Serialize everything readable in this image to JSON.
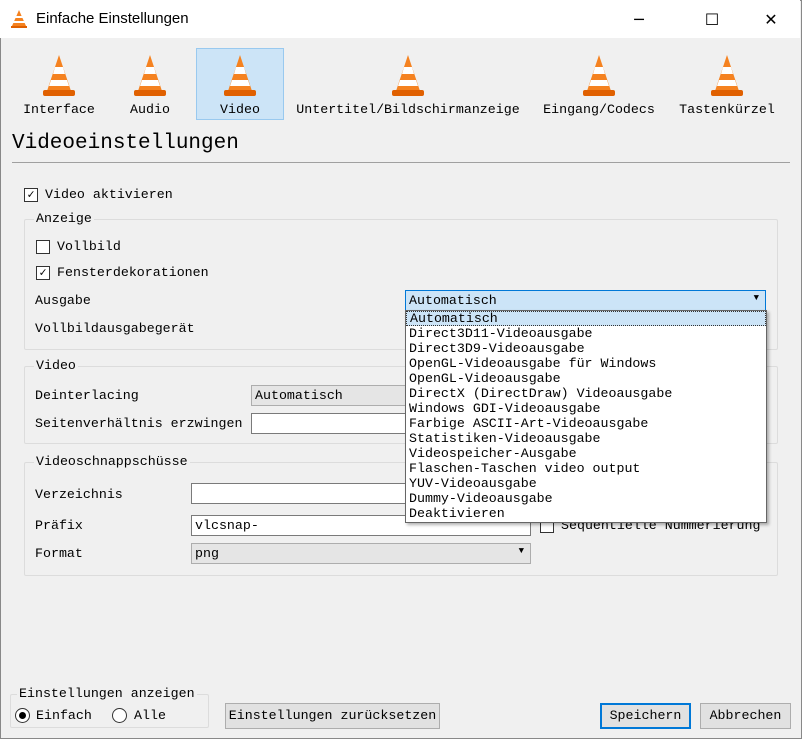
{
  "window": {
    "title": "Einfache Einstellungen",
    "minimize": "─",
    "maximize": "☐",
    "close": "✕"
  },
  "tabs": [
    {
      "label": "Interface",
      "icon": "vlc-cone-interface-icon",
      "selected": false
    },
    {
      "label": "Audio",
      "icon": "vlc-cone-headphones-icon",
      "selected": false
    },
    {
      "label": "Video",
      "icon": "vlc-cone-glasses-icon",
      "selected": true
    },
    {
      "label": "Untertitel/Bildschirmanzeige",
      "icon": "vlc-cone-subtitles-icon",
      "selected": false
    },
    {
      "label": "Eingang/Codecs",
      "icon": "vlc-cone-cables-icon",
      "selected": false
    },
    {
      "label": "Tastenkürzel",
      "icon": "vlc-cone-keys-icon",
      "selected": false
    }
  ],
  "heading": "Videoeinstellungen",
  "video_enable": {
    "label": "Video aktivieren",
    "checked": true
  },
  "display": {
    "title": "Anzeige",
    "fullscreen": {
      "label": "Vollbild",
      "checked": false
    },
    "decorations": {
      "label": "Fensterdekorationen",
      "checked": true
    },
    "output_label": "Ausgabe",
    "output_value": "Automatisch",
    "fs_device_label": "Vollbildausgabegerät"
  },
  "output_options": [
    "Automatisch",
    "Direct3D11-Videoausgabe",
    "Direct3D9-Videoausgabe",
    "OpenGL-Videoausgabe für Windows",
    "OpenGL-Videoausgabe",
    "DirectX (DirectDraw) Videoausgabe",
    "Windows GDI-Videoausgabe",
    "Farbige ASCII-Art-Videoausgabe",
    "Statistiken-Videoausgabe",
    "Videospeicher-Ausgabe",
    "Flaschen-Taschen video output",
    "YUV-Videoausgabe",
    "Dummy-Videoausgabe",
    "Deaktivieren"
  ],
  "video": {
    "title": "Video",
    "deinterlacing_label": "Deinterlacing",
    "deinterlacing_value": "Automatisch",
    "aspect_label": "Seitenverhältnis erzwingen",
    "aspect_value": ""
  },
  "snapshots": {
    "title": "Videoschnappschüsse",
    "dir_label": "Verzeichnis",
    "dir_value": "",
    "prefix_label": "Präfix",
    "prefix_value": "vlcsnap-",
    "sequential_label": "Sequentielle Nummerierung",
    "sequential_checked": false,
    "format_label": "Format",
    "format_value": "png"
  },
  "show_settings": {
    "title": "Einstellungen anzeigen",
    "simple": "Einfach",
    "all": "Alle",
    "selected": "Einfach"
  },
  "buttons": {
    "reset": "Einstellungen zurücksetzen",
    "save": "Speichern",
    "cancel": "Abbrechen"
  }
}
